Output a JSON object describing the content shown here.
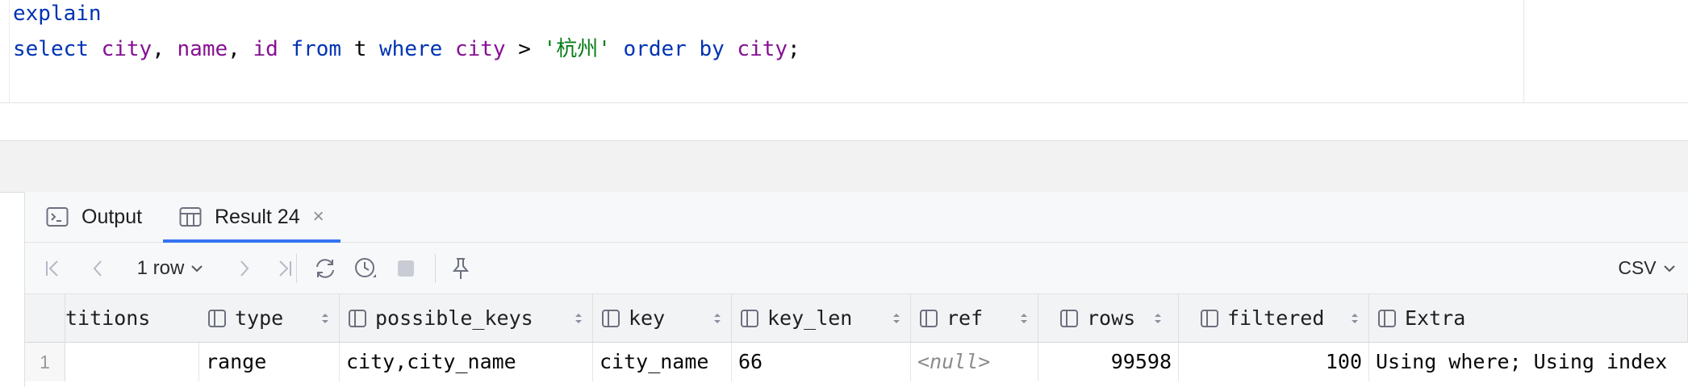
{
  "editor": {
    "line1": {
      "explain": "explain"
    },
    "line2": {
      "select": "select",
      "city": "city",
      "comma1": ", ",
      "name": "name",
      "comma2": ", ",
      "id": "id",
      "from": "from",
      "t": "t",
      "where": "where",
      "city2": "city",
      "gt": ">",
      "literal": "'杭州'",
      "order": "order",
      "by": "by",
      "city3": "city",
      "semicolon": ";"
    }
  },
  "tabs": [
    {
      "label": "Output",
      "icon": "console-icon"
    },
    {
      "label": "Result 24",
      "icon": "table-icon",
      "close": "×"
    }
  ],
  "toolbar": {
    "rows_label": "1 row",
    "format_label": "CSV",
    "icons": [
      "first-page-icon",
      "prev-page-icon",
      "next-page-icon",
      "last-page-icon",
      "refresh-icon",
      "history-icon",
      "stop-icon",
      "pin-icon"
    ]
  },
  "grid": {
    "columns": [
      {
        "label": "titions"
      },
      {
        "label": "type"
      },
      {
        "label": "possible_keys"
      },
      {
        "label": "key"
      },
      {
        "label": "key_len"
      },
      {
        "label": "ref"
      },
      {
        "label": "rows"
      },
      {
        "label": "filtered"
      },
      {
        "label": "Extra"
      }
    ],
    "rows": [
      {
        "num": "1",
        "cells": [
          "",
          "range",
          "city,city_name",
          "city_name",
          "66",
          "<null>",
          "99598",
          "100",
          "Using where; Using index"
        ]
      }
    ]
  },
  "colors": {
    "keyword": "#0033b3",
    "column": "#871094",
    "string": "#067d17",
    "accent": "#3574f0"
  }
}
